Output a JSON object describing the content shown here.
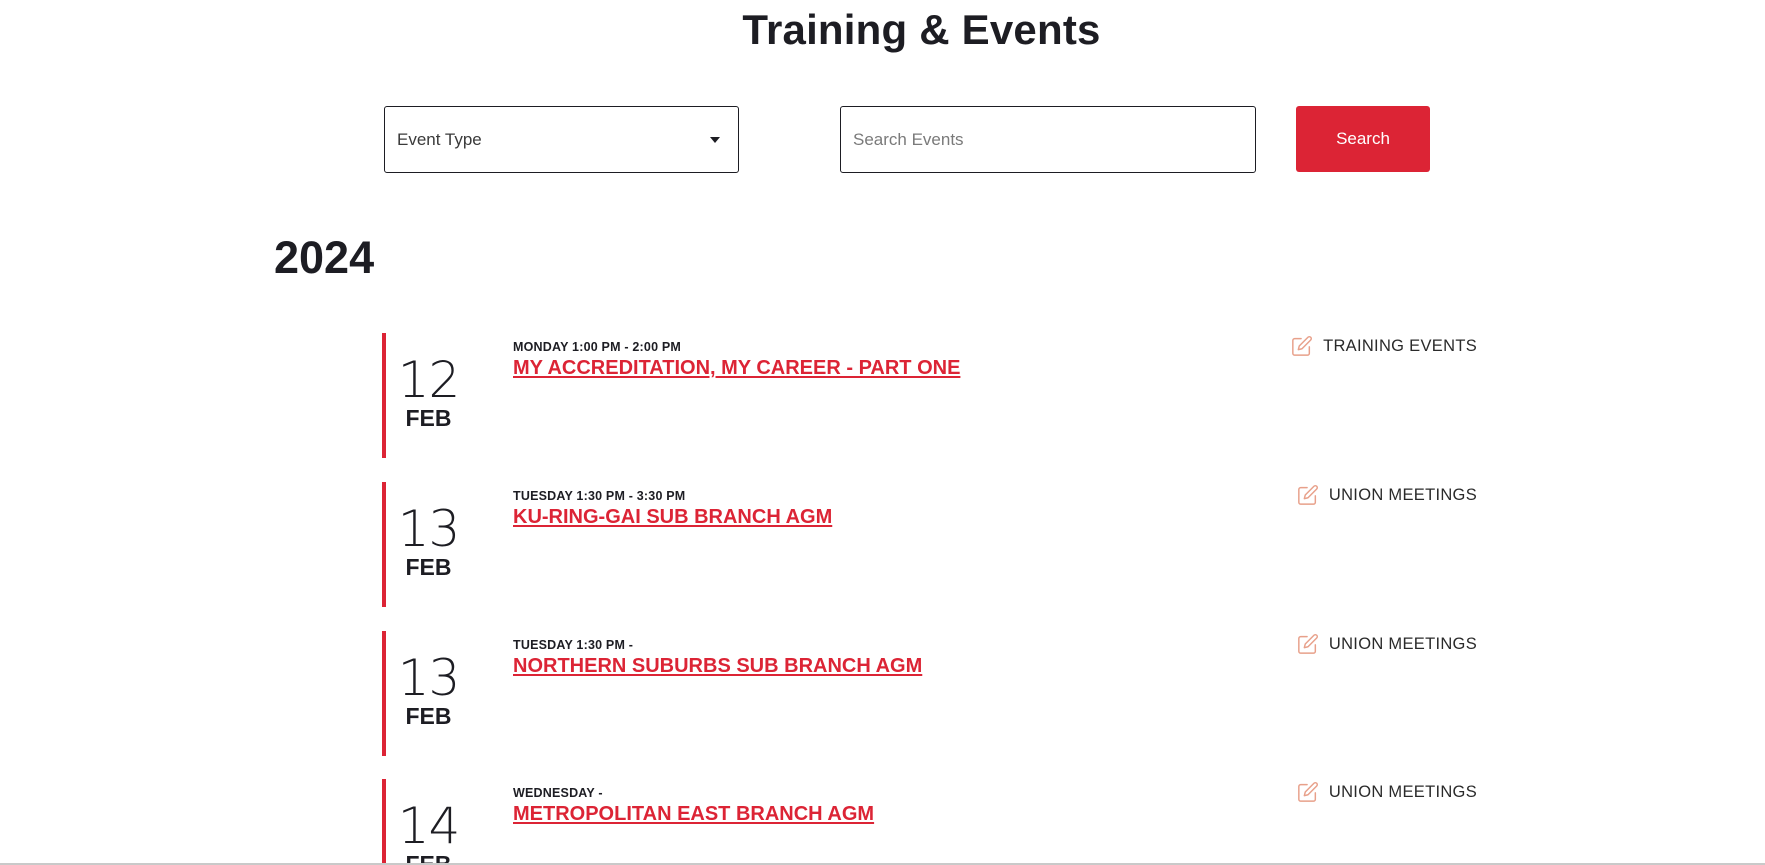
{
  "page": {
    "title": "Training & Events"
  },
  "filters": {
    "event_type_label": "Event Type",
    "search_placeholder": "Search Events",
    "search_button_label": "Search"
  },
  "year": "2024",
  "colors": {
    "accent": "#dc2435",
    "text": "#1d1d23",
    "icon": "#e8a08a"
  },
  "events": [
    {
      "day": "12",
      "month": "FEB",
      "time": "MONDAY 1:00 PM - 2:00 PM",
      "title": "MY ACCREDITATION, MY CAREER - PART ONE",
      "category": "TRAINING EVENTS",
      "category_icon": "edit-icon"
    },
    {
      "day": "13",
      "month": "FEB",
      "time": "TUESDAY 1:30 PM - 3:30 PM",
      "title": "KU-RING-GAI SUB BRANCH AGM",
      "category": "UNION MEETINGS",
      "category_icon": "edit-icon"
    },
    {
      "day": "13",
      "month": "FEB",
      "time": "TUESDAY 1:30 PM -",
      "title": "NORTHERN SUBURBS SUB BRANCH AGM",
      "category": "UNION MEETINGS",
      "category_icon": "edit-icon"
    },
    {
      "day": "14",
      "month": "FEB",
      "time": "WEDNESDAY -",
      "title": "METROPOLITAN EAST BRANCH AGM",
      "category": "UNION MEETINGS",
      "category_icon": "edit-icon"
    }
  ]
}
